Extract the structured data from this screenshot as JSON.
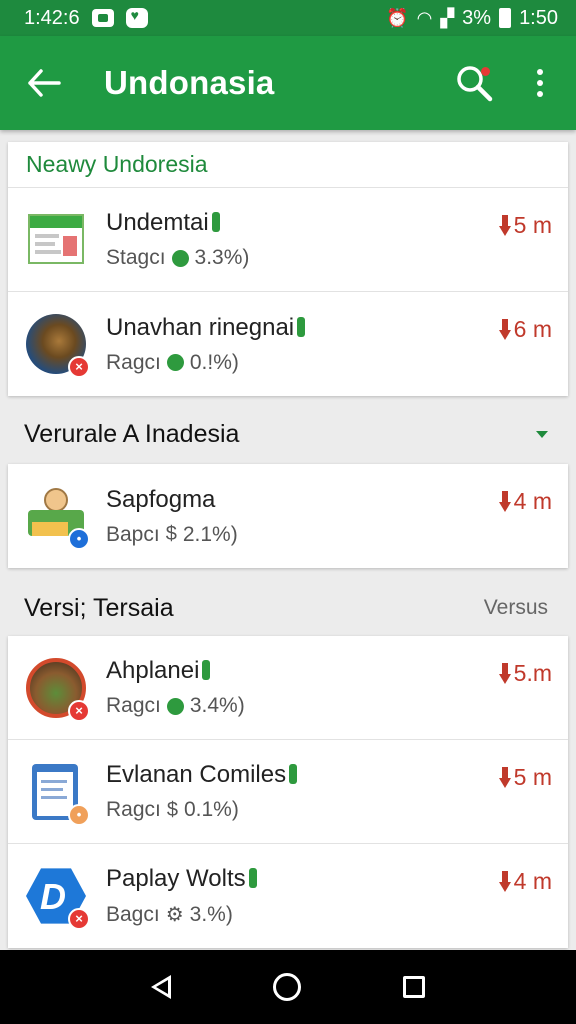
{
  "status_bar": {
    "time_left": "1:42:6",
    "battery_pct": "3%",
    "time_right": "1:50"
  },
  "app_bar": {
    "title": "Undonasia"
  },
  "card1": {
    "header": "Neawy Undoresia",
    "items": [
      {
        "name": "Undemtai",
        "sub": "Stagcı",
        "value": "3.3%)",
        "size": "5 m",
        "icon": "document-app-icon"
      },
      {
        "name": "Unavhan rinegnai",
        "sub": "Ragcı",
        "value": "0.!%)",
        "size": "6 m",
        "icon": "animal-app-icon"
      }
    ]
  },
  "section1": {
    "title": "Verurale A Inadesia"
  },
  "card2": {
    "items": [
      {
        "name": "Sapfogma",
        "sub": "Bapcı",
        "value": "2.1%)",
        "size": "4 m",
        "icon": "person-card-icon"
      }
    ]
  },
  "section2": {
    "title": "Versi; Tersaia",
    "action": "Versus"
  },
  "card3": {
    "items": [
      {
        "name": "Ahplanei",
        "sub": "Ragcı",
        "value": "3.4%)",
        "size": "5.m",
        "icon": "landscape-app-icon"
      },
      {
        "name": "Evlanan Comiles",
        "sub": "Ragcı",
        "value": "0.1%)",
        "size": "5 m",
        "icon": "clipboard-app-icon"
      },
      {
        "name": "Paplay Wolts",
        "sub": "Bagcı",
        "value": "3.%)",
        "size": "4 m",
        "icon": "d-hexagon-icon"
      }
    ]
  },
  "colors": {
    "appbar": "#1f9a43",
    "statusbar": "#1e8a3e",
    "size_text": "#c0392b",
    "header_green": "#1f8a3c"
  }
}
